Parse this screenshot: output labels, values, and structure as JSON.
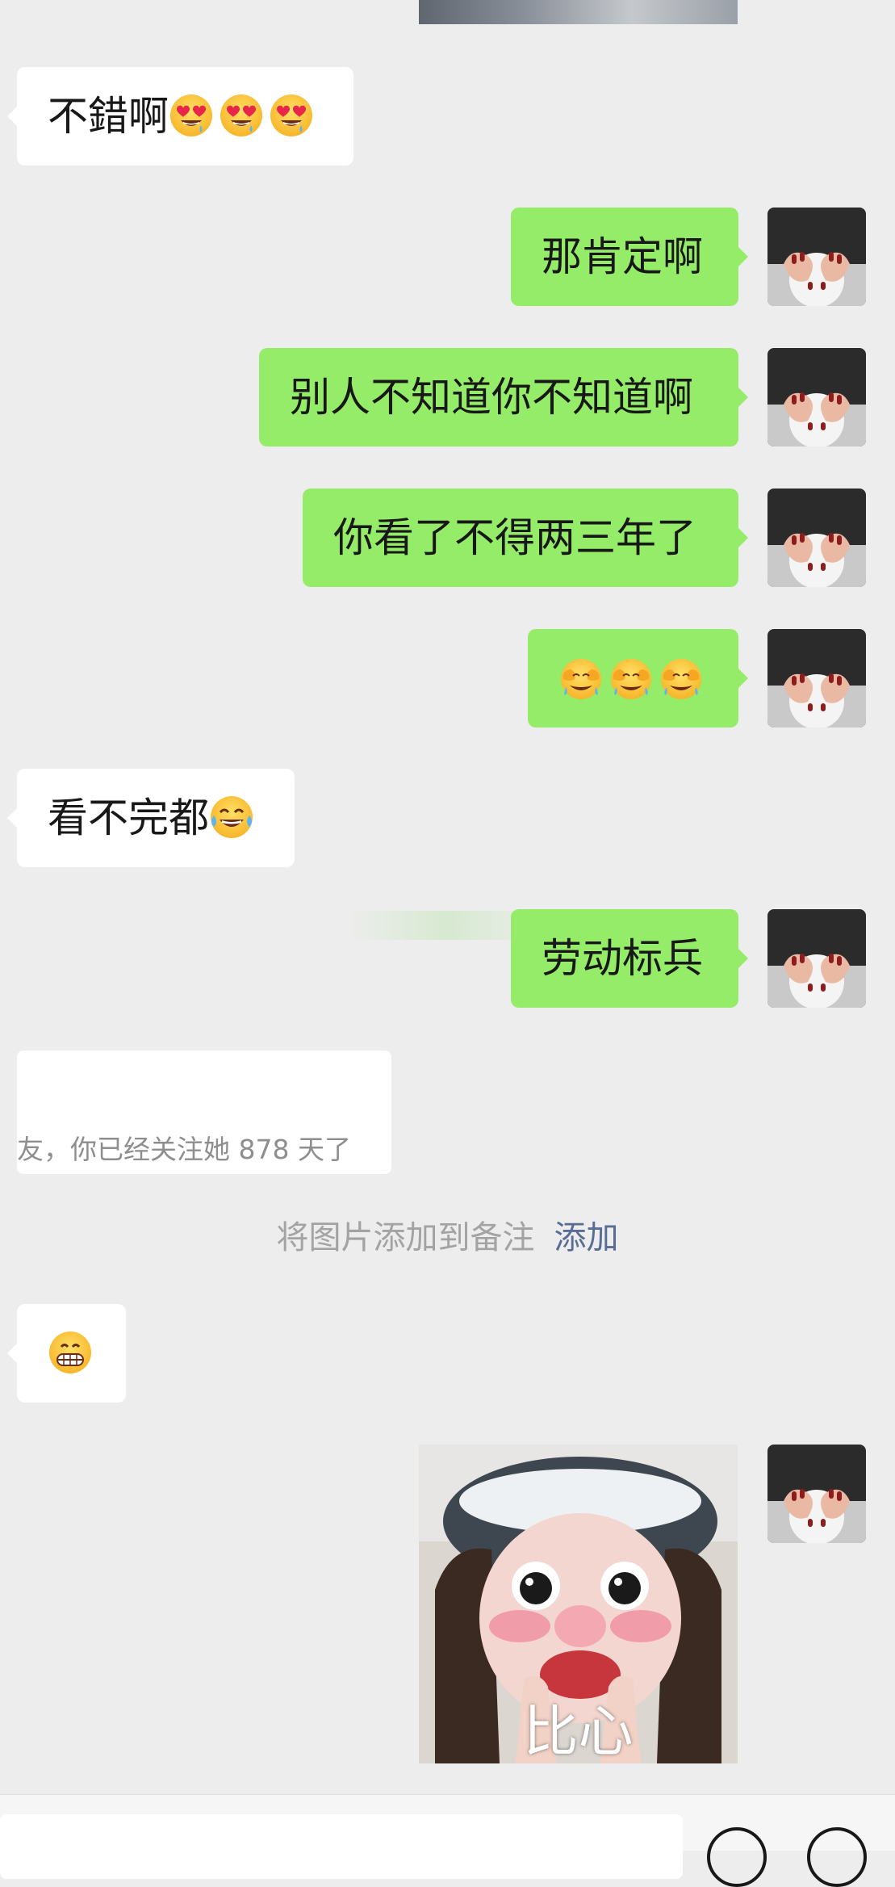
{
  "messages": [
    {
      "side": "in",
      "text": "不錯啊",
      "emoji": [
        "heart-eyes",
        "heart-eyes",
        "heart-eyes"
      ]
    },
    {
      "side": "out",
      "text": "那肯定啊"
    },
    {
      "side": "out",
      "text": "别人不知道你不知道啊"
    },
    {
      "side": "out",
      "text": "你看了不得两三年了"
    },
    {
      "side": "out",
      "text": "",
      "emoji": [
        "face-palm-laugh",
        "face-palm-laugh",
        "face-palm-laugh"
      ]
    },
    {
      "side": "in",
      "text": "看不完都",
      "emoji": [
        "tears-of-joy"
      ]
    },
    {
      "side": "out",
      "text": "劳动标兵"
    },
    {
      "side": "in",
      "text": "",
      "emoji": [
        "grimacing"
      ]
    }
  ],
  "quote_card": {
    "text": "友，你已经关注她 878 天了"
  },
  "system_note": {
    "text": "将图片添加到备注",
    "action": "添加"
  },
  "sticker": {
    "caption": "比心"
  },
  "colors": {
    "background": "#ededed",
    "incoming_bubble": "#ffffff",
    "outgoing_bubble": "#95ec69",
    "link": "#586c94"
  }
}
